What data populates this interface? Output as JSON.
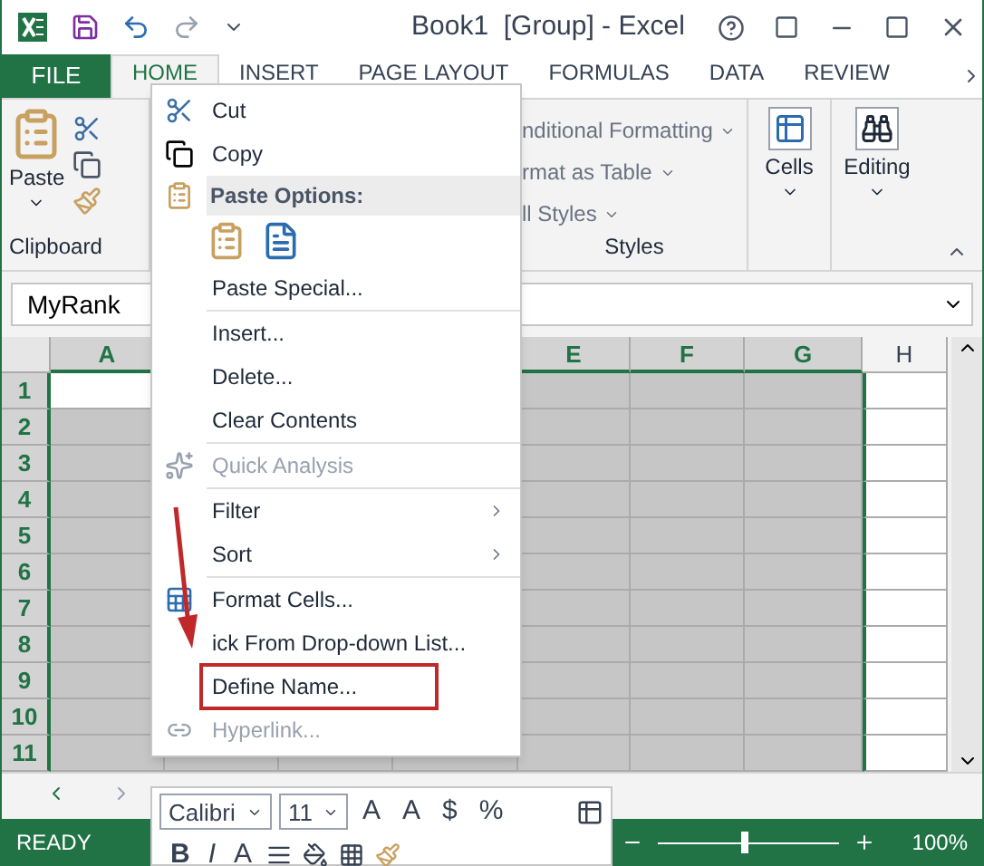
{
  "window": {
    "title": "Book1  [Group] - Excel"
  },
  "tabs": [
    {
      "label": "FILE",
      "kind": "file",
      "selected": false
    },
    {
      "label": "HOME",
      "kind": "tab",
      "selected": true
    },
    {
      "label": "INSERT",
      "kind": "tab",
      "selected": false
    },
    {
      "label": "PAGE LAYOUT",
      "kind": "tab",
      "selected": false
    },
    {
      "label": "FORMULAS",
      "kind": "tab",
      "selected": false
    },
    {
      "label": "DATA",
      "kind": "tab",
      "selected": false
    },
    {
      "label": "REVIEW",
      "kind": "tab",
      "selected": false
    }
  ],
  "ribbon": {
    "paste_label": "Paste",
    "clipboard_label": "Clipboard",
    "styles": [
      "nditional Formatting",
      "rmat as Table",
      "ll Styles"
    ],
    "styles_label": "Styles",
    "cells_label": "Cells",
    "editing_label": "Editing"
  },
  "name_box": {
    "value": "MyRank"
  },
  "sheet": {
    "columns": [
      {
        "label": "A",
        "selected": true
      },
      {
        "label": "E",
        "selected": true
      },
      {
        "label": "F",
        "selected": true
      },
      {
        "label": "G",
        "selected": true
      },
      {
        "label": "H",
        "selected": false
      }
    ],
    "rows": [
      "1",
      "2",
      "3",
      "4",
      "5",
      "6",
      "7",
      "8",
      "9",
      "10",
      "11"
    ]
  },
  "context_menu": [
    {
      "kind": "cut",
      "label": "Cut",
      "disabled": false,
      "submenu": false,
      "boxed": false
    },
    {
      "kind": "copy",
      "label": "Copy",
      "disabled": false,
      "submenu": false,
      "boxed": false
    },
    {
      "kind": "header",
      "label": "Paste Options:"
    },
    {
      "kind": "paste-icons"
    },
    {
      "kind": "plain",
      "label": "Paste Special...",
      "disabled": false,
      "submenu": false,
      "boxed": false
    },
    {
      "kind": "separator"
    },
    {
      "kind": "plain",
      "label": "Insert...",
      "disabled": false,
      "submenu": false,
      "boxed": false
    },
    {
      "kind": "plain",
      "label": "Delete...",
      "disabled": false,
      "submenu": false,
      "boxed": false
    },
    {
      "kind": "plain",
      "label": "Clear Contents",
      "disabled": false,
      "submenu": false,
      "boxed": false
    },
    {
      "kind": "separator"
    },
    {
      "kind": "analysis",
      "label": "Quick Analysis",
      "disabled": true,
      "submenu": false,
      "boxed": false
    },
    {
      "kind": "separator"
    },
    {
      "kind": "plain",
      "label": "Filter",
      "disabled": false,
      "submenu": true,
      "boxed": false
    },
    {
      "kind": "plain",
      "label": "Sort",
      "disabled": false,
      "submenu": true,
      "boxed": false
    },
    {
      "kind": "separator"
    },
    {
      "kind": "format",
      "label": "Format Cells...",
      "disabled": false,
      "submenu": false,
      "boxed": false
    },
    {
      "kind": "plain",
      "label": "ick From Drop-down List...",
      "disabled": false,
      "submenu": false,
      "boxed": false
    },
    {
      "kind": "plain",
      "label": "Define Name...",
      "disabled": false,
      "submenu": false,
      "boxed": true
    },
    {
      "kind": "link",
      "label": "Hyperlink...",
      "disabled": true,
      "submenu": false,
      "boxed": false
    }
  ],
  "mini_toolbar": {
    "font": "Calibri",
    "size": "11",
    "row1": [
      "A",
      "A",
      "$",
      "%"
    ],
    "row2": [
      "B",
      "I",
      "A"
    ]
  },
  "status_bar": {
    "status": "READY",
    "zoom": "100%",
    "zoom_level": {
      "level": 0.48
    }
  }
}
